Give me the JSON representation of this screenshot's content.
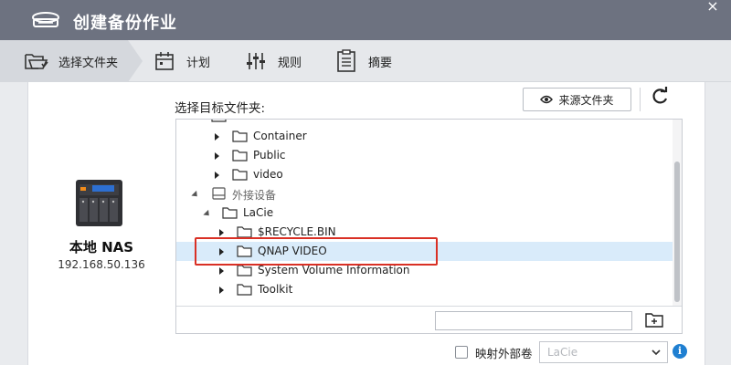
{
  "window": {
    "title": "创建备份作业",
    "close_glyph": "×"
  },
  "steps": [
    {
      "label": "选择文件夹",
      "icon": "folder-select-icon",
      "active": true
    },
    {
      "label": "计划",
      "icon": "calendar-icon",
      "active": false
    },
    {
      "label": "规则",
      "icon": "sliders-icon",
      "active": false
    },
    {
      "label": "摘要",
      "icon": "clipboard-icon",
      "active": false
    }
  ],
  "nas": {
    "name": "本地 NAS",
    "ip": "192.168.50.136",
    "icon": "nas-device-icon"
  },
  "target": {
    "label": "选择目标文件夹:",
    "source_button": "来源文件夹",
    "source_icon": "eye-icon",
    "refresh_icon": "refresh-icon"
  },
  "tree": {
    "rows": [
      {
        "label": "Container"
      },
      {
        "label": "Public"
      },
      {
        "label": "video"
      },
      {
        "label": "外接设备"
      },
      {
        "label": "LaCie"
      },
      {
        "label": "$RECYCLE.BIN"
      },
      {
        "label": "QNAP VIDEO"
      },
      {
        "label": "System Volume Information"
      },
      {
        "label": "Toolkit"
      }
    ],
    "selected": "QNAP VIDEO",
    "new_folder_value": "",
    "new_folder_icon": "new-folder-icon"
  },
  "map": {
    "label": "映射外部卷",
    "checked": false,
    "select_value": "LaCie",
    "info_glyph": "i"
  },
  "colors": {
    "titlebar": "#6d7280",
    "selection": "#d9ebfa",
    "highlight_border": "#d93025",
    "info": "#1f7fd1"
  }
}
